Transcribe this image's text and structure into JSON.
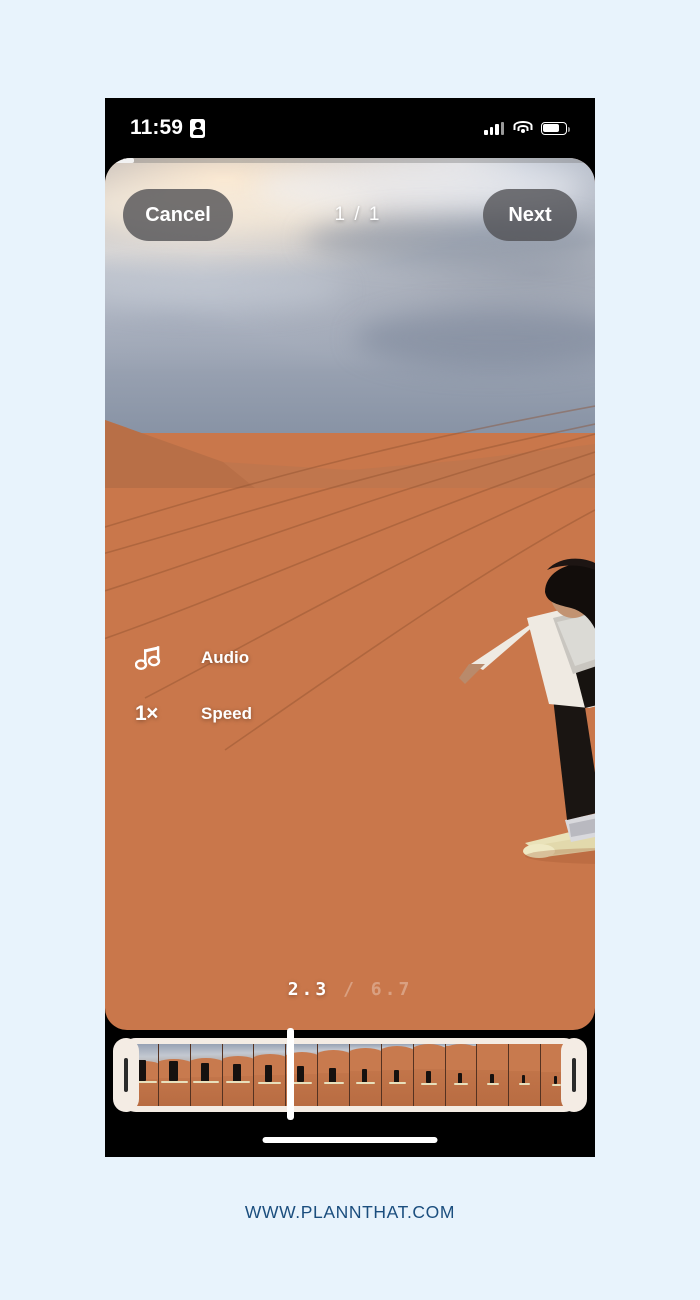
{
  "page": {
    "background_color": "#e8f3fc",
    "footer_text": "WWW.PLANNTHAT.COM",
    "footer_color": "#1b4e7e"
  },
  "status_bar": {
    "time": "11:59",
    "recording_icon": "id-card-icon",
    "cellular_icon": "cellular-bars-icon",
    "wifi_icon": "wifi-icon",
    "battery_icon": "battery-icon",
    "battery_level_percent": 72
  },
  "editor": {
    "progress_percent": 6,
    "accent_color": "#ff3b6b",
    "top_bar": {
      "cancel_label": "Cancel",
      "counter_label": "1 / 1",
      "next_label": "Next"
    },
    "tools": [
      {
        "icon": "music-note-icon",
        "label": "Audio",
        "glyph": ""
      },
      {
        "icon": "speed-icon",
        "label": "Speed",
        "glyph": "1×"
      }
    ],
    "time_readout": {
      "current": "2.3",
      "separator": "/",
      "total": "6.7"
    },
    "timeline": {
      "frame_count": 14,
      "playhead_position_percent": 37,
      "left_handle": "trim-start-handle",
      "right_handle": "trim-end-handle"
    }
  },
  "media": {
    "description": "sandboarder-on-desert-dune",
    "sand_color": "#c8794e",
    "sky_color": "#b2b8c4"
  }
}
